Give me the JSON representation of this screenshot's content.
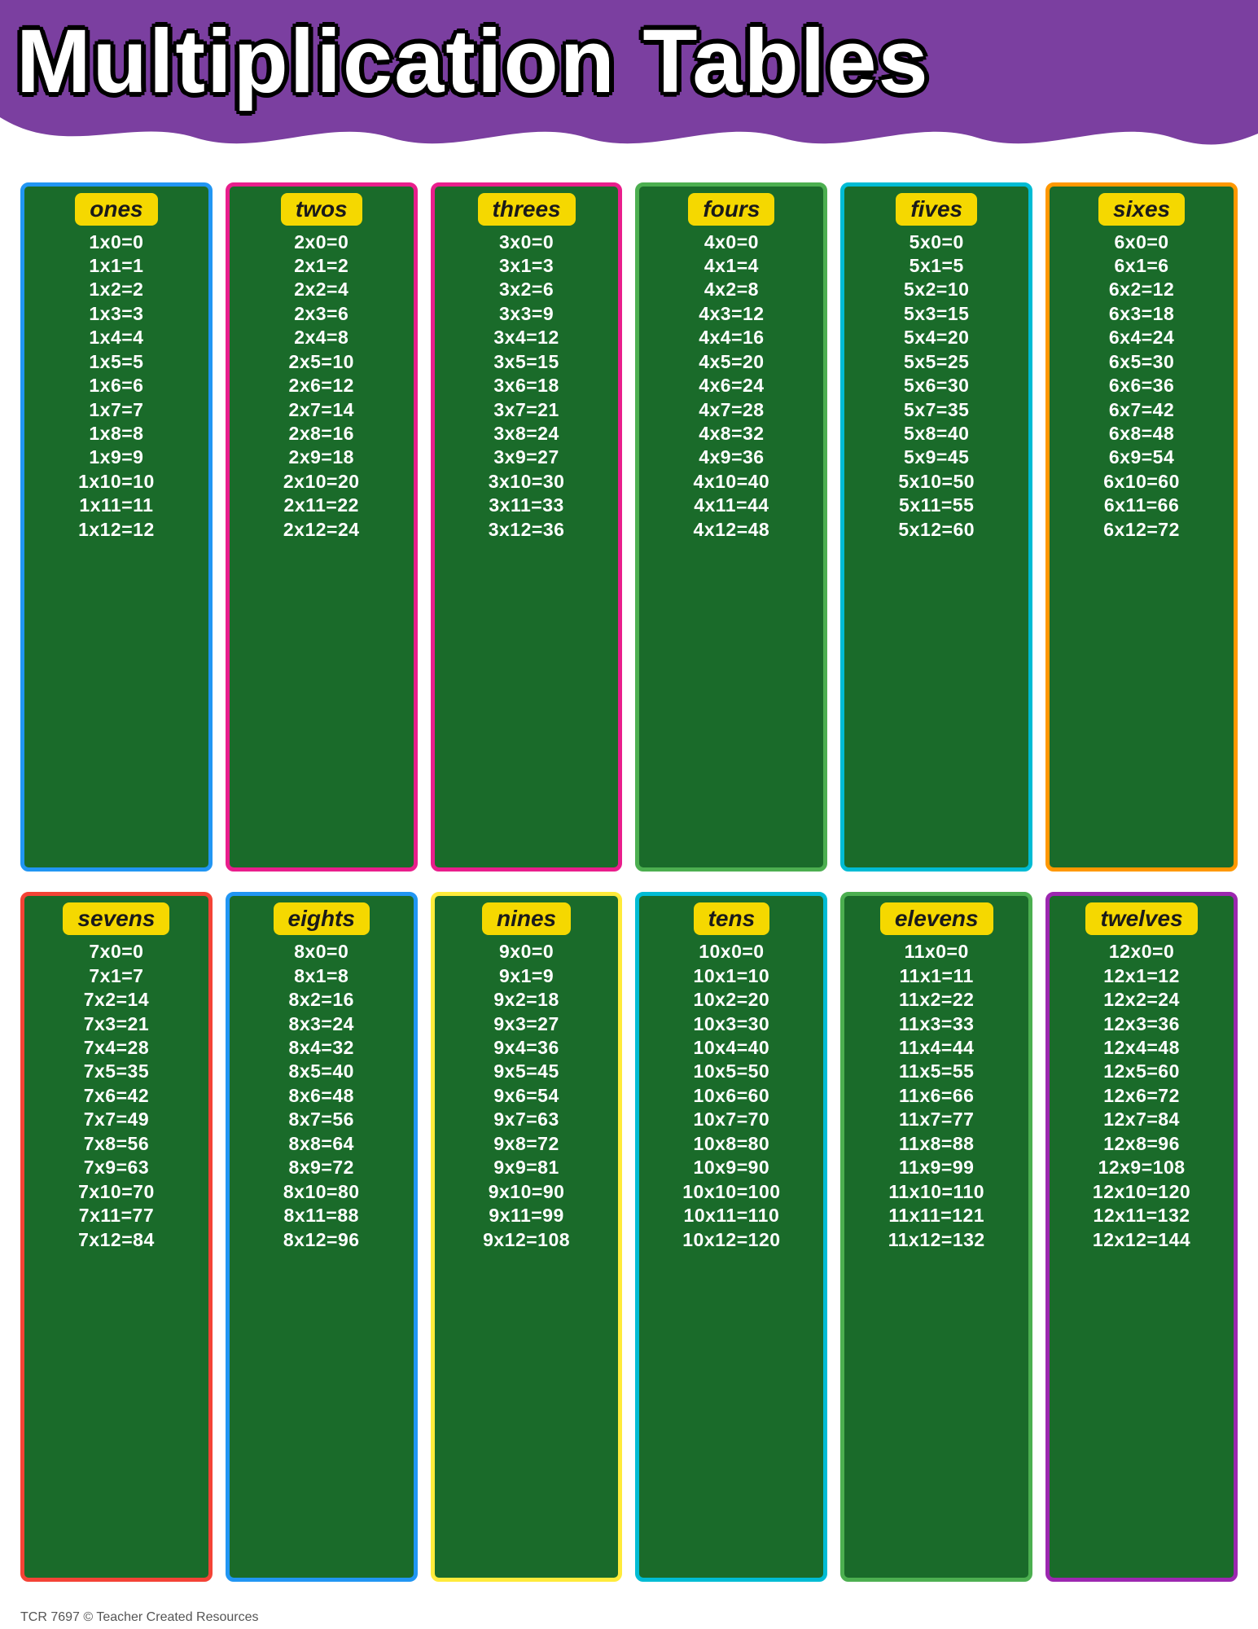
{
  "header": {
    "title": "Multiplication Tables",
    "bg_color": "#7b3fa0"
  },
  "footer": "TCR 7697  © Teacher Created Resources",
  "tables": [
    {
      "id": "ones",
      "label": "ones",
      "border_class": "card-blue",
      "equations": [
        "1x0=0",
        "1x1=1",
        "1x2=2",
        "1x3=3",
        "1x4=4",
        "1x5=5",
        "1x6=6",
        "1x7=7",
        "1x8=8",
        "1x9=9",
        "1x10=10",
        "1x11=11",
        "1x12=12"
      ]
    },
    {
      "id": "twos",
      "label": "twos",
      "border_class": "card-pink",
      "equations": [
        "2x0=0",
        "2x1=2",
        "2x2=4",
        "2x3=6",
        "2x4=8",
        "2x5=10",
        "2x6=12",
        "2x7=14",
        "2x8=16",
        "2x9=18",
        "2x10=20",
        "2x11=22",
        "2x12=24"
      ]
    },
    {
      "id": "threes",
      "label": "threes",
      "border_class": "card-pink",
      "equations": [
        "3x0=0",
        "3x1=3",
        "3x2=6",
        "3x3=9",
        "3x4=12",
        "3x5=15",
        "3x6=18",
        "3x7=21",
        "3x8=24",
        "3x9=27",
        "3x10=30",
        "3x11=33",
        "3x12=36"
      ]
    },
    {
      "id": "fours",
      "label": "fours",
      "border_class": "card-green-border",
      "equations": [
        "4x0=0",
        "4x1=4",
        "4x2=8",
        "4x3=12",
        "4x4=16",
        "4x5=20",
        "4x6=24",
        "4x7=28",
        "4x8=32",
        "4x9=36",
        "4x10=40",
        "4x11=44",
        "4x12=48"
      ]
    },
    {
      "id": "fives",
      "label": "fives",
      "border_class": "card-teal",
      "equations": [
        "5x0=0",
        "5x1=5",
        "5x2=10",
        "5x3=15",
        "5x4=20",
        "5x5=25",
        "5x6=30",
        "5x7=35",
        "5x8=40",
        "5x9=45",
        "5x10=50",
        "5x11=55",
        "5x12=60"
      ]
    },
    {
      "id": "sixes",
      "label": "sixes",
      "border_class": "card-orange",
      "equations": [
        "6x0=0",
        "6x1=6",
        "6x2=12",
        "6x3=18",
        "6x4=24",
        "6x5=30",
        "6x6=36",
        "6x7=42",
        "6x8=48",
        "6x9=54",
        "6x10=60",
        "6x11=66",
        "6x12=72"
      ]
    },
    {
      "id": "sevens",
      "label": "sevens",
      "border_class": "card-red",
      "equations": [
        "7x0=0",
        "7x1=7",
        "7x2=14",
        "7x3=21",
        "7x4=28",
        "7x5=35",
        "7x6=42",
        "7x7=49",
        "7x8=56",
        "7x9=63",
        "7x10=70",
        "7x11=77",
        "7x12=84"
      ]
    },
    {
      "id": "eights",
      "label": "eights",
      "border_class": "card-blue",
      "equations": [
        "8x0=0",
        "8x1=8",
        "8x2=16",
        "8x3=24",
        "8x4=32",
        "8x5=40",
        "8x6=48",
        "8x7=56",
        "8x8=64",
        "8x9=72",
        "8x10=80",
        "8x11=88",
        "8x12=96"
      ]
    },
    {
      "id": "nines",
      "label": "nines",
      "border_class": "card-yellow-border",
      "equations": [
        "9x0=0",
        "9x1=9",
        "9x2=18",
        "9x3=27",
        "9x4=36",
        "9x5=45",
        "9x6=54",
        "9x7=63",
        "9x8=72",
        "9x9=81",
        "9x10=90",
        "9x11=99",
        "9x12=108"
      ]
    },
    {
      "id": "tens",
      "label": "tens",
      "border_class": "card-teal",
      "equations": [
        "10x0=0",
        "10x1=10",
        "10x2=20",
        "10x3=30",
        "10x4=40",
        "10x5=50",
        "10x6=60",
        "10x7=70",
        "10x8=80",
        "10x9=90",
        "10x10=100",
        "10x11=110",
        "10x12=120"
      ]
    },
    {
      "id": "elevens",
      "label": "elevens",
      "border_class": "card-green-border",
      "equations": [
        "11x0=0",
        "11x1=11",
        "11x2=22",
        "11x3=33",
        "11x4=44",
        "11x5=55",
        "11x6=66",
        "11x7=77",
        "11x8=88",
        "11x9=99",
        "11x10=110",
        "11x11=121",
        "11x12=132"
      ]
    },
    {
      "id": "twelves",
      "label": "twelves",
      "border_class": "card-purple-border",
      "equations": [
        "12x0=0",
        "12x1=12",
        "12x2=24",
        "12x3=36",
        "12x4=48",
        "12x5=60",
        "12x6=72",
        "12x7=84",
        "12x8=96",
        "12x9=108",
        "12x10=120",
        "12x11=132",
        "12x12=144"
      ]
    }
  ]
}
